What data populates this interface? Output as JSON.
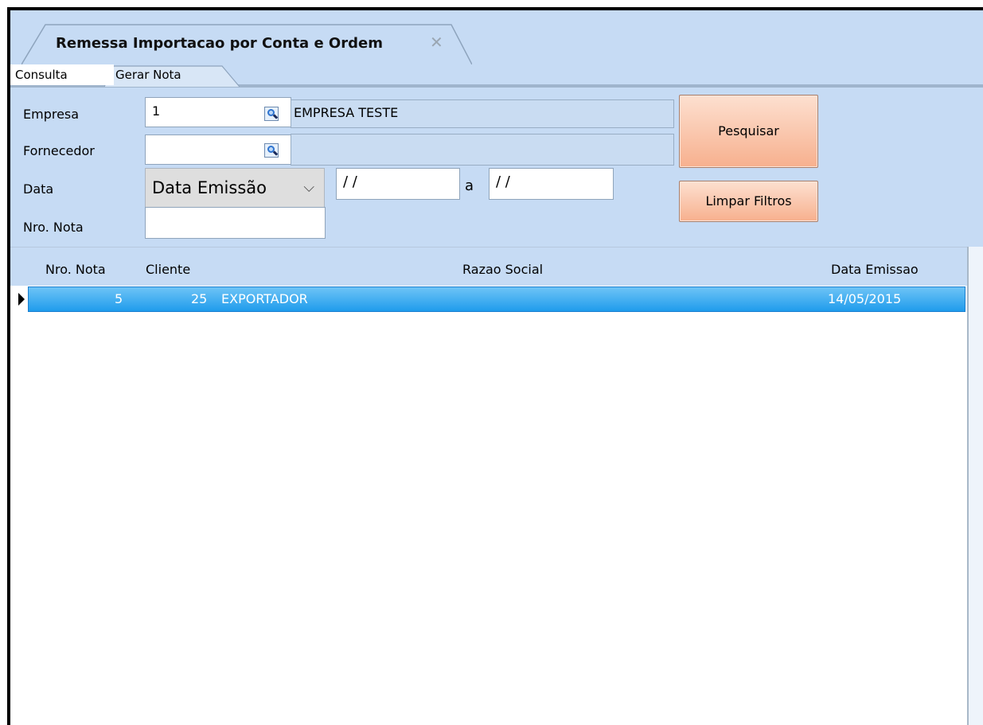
{
  "window": {
    "tab_title": "Remessa Importacao por Conta e Ordem",
    "close_glyph": "✕"
  },
  "subtabs": [
    {
      "label": "Consulta"
    },
    {
      "label": "Gerar Nota"
    }
  ],
  "filters": {
    "empresa": {
      "label": "Empresa",
      "value": "1",
      "description": "EMPRESA TESTE"
    },
    "fornecedor": {
      "label": "Fornecedor",
      "value": "",
      "description": ""
    },
    "data": {
      "label": "Data",
      "type_selected": "Data Emissão",
      "from": "/ /",
      "separator": "a",
      "to": "/ /"
    },
    "nro_nota": {
      "label": "Nro. Nota",
      "value": ""
    }
  },
  "buttons": {
    "pesquisar": "Pesquisar",
    "limpar": "Limpar Filtros"
  },
  "grid": {
    "columns": [
      "Nro. Nota",
      "Cliente",
      "Razao Social",
      "Data Emissao"
    ],
    "rows": [
      {
        "nro_nota": "5",
        "cliente": "25",
        "razao_social": "EXPORTADOR",
        "data_emissao": "14/05/2015"
      }
    ]
  },
  "colors": {
    "panel_bg": "#c6dbf4",
    "selected_row": "#1f9cec",
    "button_accent": "#f7b08e"
  }
}
